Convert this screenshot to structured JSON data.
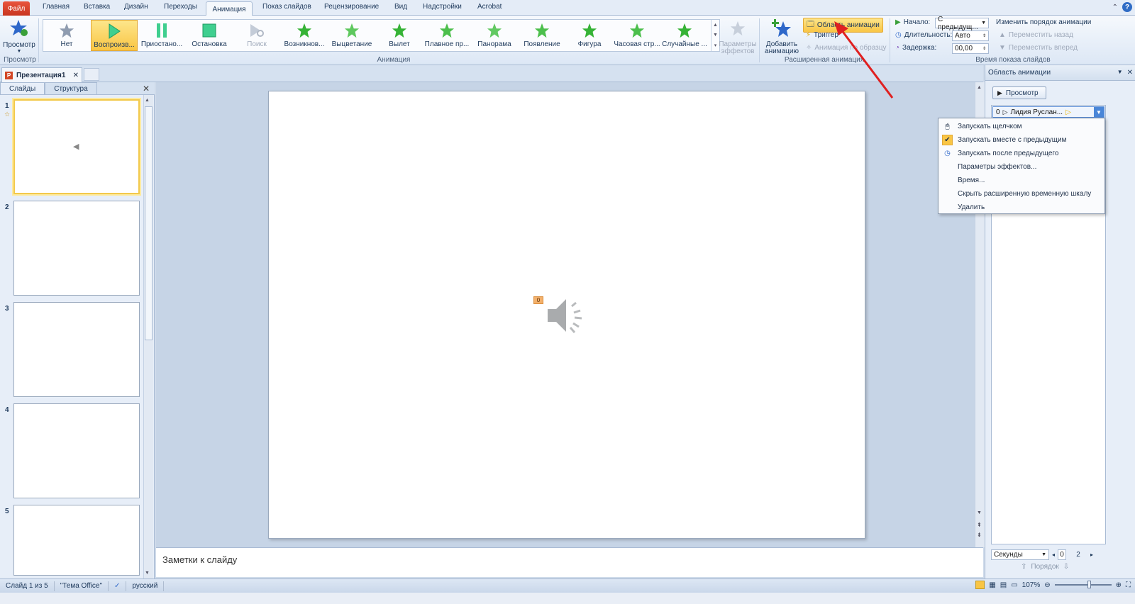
{
  "ribbon_tabs": {
    "file": "Файл",
    "home": "Главная",
    "insert": "Вставка",
    "design": "Дизайн",
    "transitions": "Переходы",
    "animation": "Анимация",
    "slideshow": "Показ слайдов",
    "review": "Рецензирование",
    "view": "Вид",
    "addins": "Надстройки",
    "acrobat": "Acrobat"
  },
  "ribbon": {
    "preview_group": {
      "button": "Просмотр",
      "label": "Просмотр"
    },
    "animation_group": {
      "label": "Анимация",
      "gallery": [
        {
          "label": "Нет"
        },
        {
          "label": "Воспроизв..."
        },
        {
          "label": "Приостано..."
        },
        {
          "label": "Остановка"
        },
        {
          "label": "Поиск"
        },
        {
          "label": "Возникнов..."
        },
        {
          "label": "Выцветание"
        },
        {
          "label": "Вылет"
        },
        {
          "label": "Плавное пр..."
        },
        {
          "label": "Панорама"
        },
        {
          "label": "Появление"
        },
        {
          "label": "Фигура"
        },
        {
          "label": "Часовая стр..."
        },
        {
          "label": "Случайные ..."
        }
      ],
      "effect_params": "Параметры эффектов"
    },
    "advanced_group": {
      "label": "Расширенная анимация",
      "add_animation": "Добавить анимацию",
      "animation_pane": "Область анимации",
      "trigger": "Триггер",
      "anim_painter": "Анимация по образцу"
    },
    "timing_group": {
      "label": "Время показа слайдов",
      "start_label": "Начало:",
      "start_value": "С предыдущ...",
      "duration_label": "Длительность:",
      "duration_value": "Авто",
      "delay_label": "Задержка:",
      "delay_value": "00,00",
      "reorder_title": "Изменить порядок анимации",
      "move_earlier": "Переместить назад",
      "move_later": "Переместить вперед"
    }
  },
  "document_tab": {
    "title": "Презентация1"
  },
  "slides_pane": {
    "tabs": [
      "Слайды",
      "Структура"
    ],
    "slides": [
      {
        "num": "1"
      },
      {
        "num": "2"
      },
      {
        "num": "3"
      },
      {
        "num": "4"
      },
      {
        "num": "5"
      }
    ]
  },
  "editor": {
    "badge": "0",
    "notes_placeholder": "Заметки к слайду"
  },
  "animation_pane": {
    "title": "Область анимации",
    "preview": "Просмотр",
    "item": {
      "index": "0",
      "name": "Лидия Руслан..."
    },
    "seconds": "Секунды",
    "timeline_start": "0",
    "timeline_end": "2",
    "order": "Порядок"
  },
  "context_menu": [
    {
      "label": "Запускать щелчком",
      "checked": false
    },
    {
      "label": "Запускать вместе с предыдущим",
      "checked": true
    },
    {
      "label": "Запускать после предыдущего",
      "checked": false
    },
    {
      "label": "Параметры эффектов..."
    },
    {
      "label": "Время..."
    },
    {
      "label": "Скрыть расширенную временную шкалу"
    },
    {
      "label": "Удалить"
    }
  ],
  "status_bar": {
    "slide_info": "Слайд 1 из 5",
    "theme": "\"Тема Office\"",
    "language": "русский",
    "zoom": "107%"
  },
  "colors": {
    "accent": "#f9c544",
    "file_tab": "#c8361f",
    "arrow": "#e02020"
  }
}
